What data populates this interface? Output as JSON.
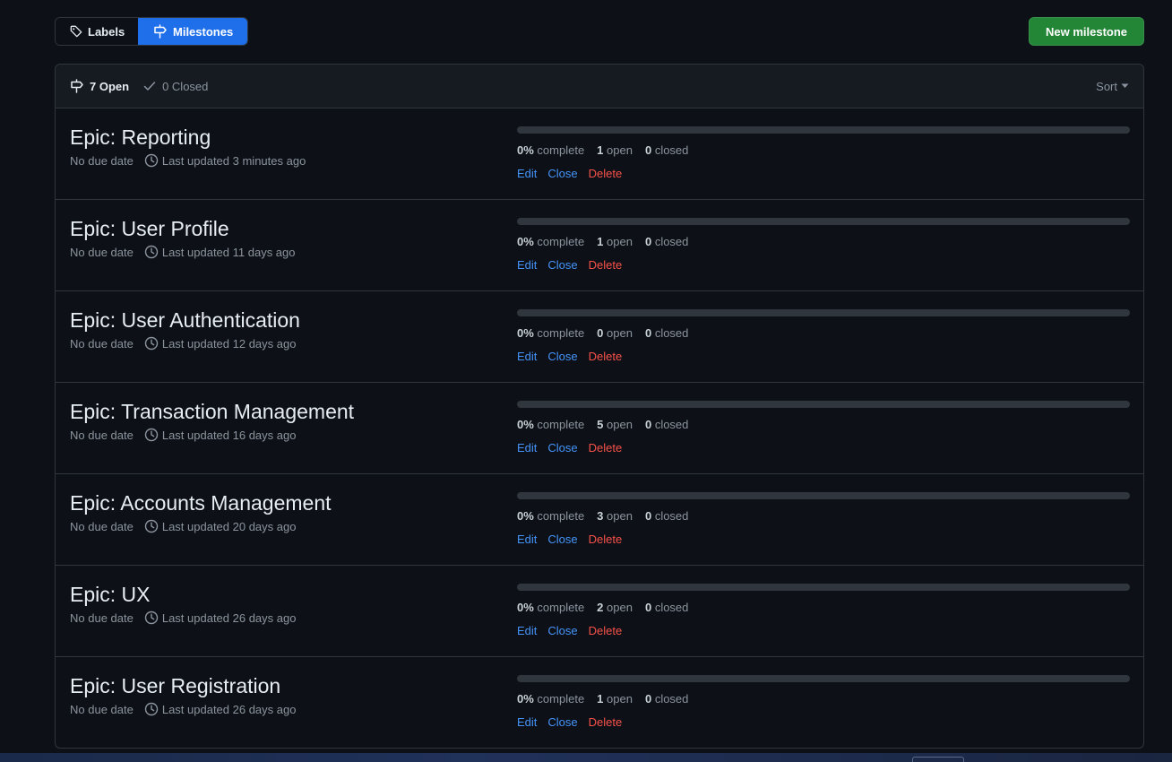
{
  "nav": {
    "labels_label": "Labels",
    "milestones_label": "Milestones",
    "new_milestone_label": "New milestone"
  },
  "header": {
    "open_label": "7 Open",
    "closed_label": "0 Closed",
    "sort_label": "Sort"
  },
  "colors": {
    "accent": "#1f6feb",
    "primary_button": "#238636",
    "link": "#4493f8",
    "danger": "#f85149"
  },
  "milestones": [
    {
      "title": "Epic: Reporting",
      "due": "No due date",
      "updated": "Last updated 3 minutes ago",
      "percent_label": "0%",
      "complete_label": "complete",
      "progress": 0,
      "open_count": "1",
      "open_label": "open",
      "closed_count": "0",
      "closed_label": "closed",
      "edit": "Edit",
      "close": "Close",
      "delete": "Delete"
    },
    {
      "title": "Epic: User Profile",
      "due": "No due date",
      "updated": "Last updated 11 days ago",
      "percent_label": "0%",
      "complete_label": "complete",
      "progress": 0,
      "open_count": "1",
      "open_label": "open",
      "closed_count": "0",
      "closed_label": "closed",
      "edit": "Edit",
      "close": "Close",
      "delete": "Delete"
    },
    {
      "title": "Epic: User Authentication",
      "due": "No due date",
      "updated": "Last updated 12 days ago",
      "percent_label": "0%",
      "complete_label": "complete",
      "progress": 0,
      "open_count": "0",
      "open_label": "open",
      "closed_count": "0",
      "closed_label": "closed",
      "edit": "Edit",
      "close": "Close",
      "delete": "Delete"
    },
    {
      "title": "Epic: Transaction Management",
      "due": "No due date",
      "updated": "Last updated 16 days ago",
      "percent_label": "0%",
      "complete_label": "complete",
      "progress": 0,
      "open_count": "5",
      "open_label": "open",
      "closed_count": "0",
      "closed_label": "closed",
      "edit": "Edit",
      "close": "Close",
      "delete": "Delete"
    },
    {
      "title": "Epic: Accounts Management",
      "due": "No due date",
      "updated": "Last updated 20 days ago",
      "percent_label": "0%",
      "complete_label": "complete",
      "progress": 0,
      "open_count": "3",
      "open_label": "open",
      "closed_count": "0",
      "closed_label": "closed",
      "edit": "Edit",
      "close": "Close",
      "delete": "Delete"
    },
    {
      "title": "Epic: UX",
      "due": "No due date",
      "updated": "Last updated 26 days ago",
      "percent_label": "0%",
      "complete_label": "complete",
      "progress": 0,
      "open_count": "2",
      "open_label": "open",
      "closed_count": "0",
      "closed_label": "closed",
      "edit": "Edit",
      "close": "Close",
      "delete": "Delete"
    },
    {
      "title": "Epic: User Registration",
      "due": "No due date",
      "updated": "Last updated 26 days ago",
      "percent_label": "0%",
      "complete_label": "complete",
      "progress": 0,
      "open_count": "1",
      "open_label": "open",
      "closed_count": "0",
      "closed_label": "closed",
      "edit": "Edit",
      "close": "Close",
      "delete": "Delete"
    }
  ]
}
